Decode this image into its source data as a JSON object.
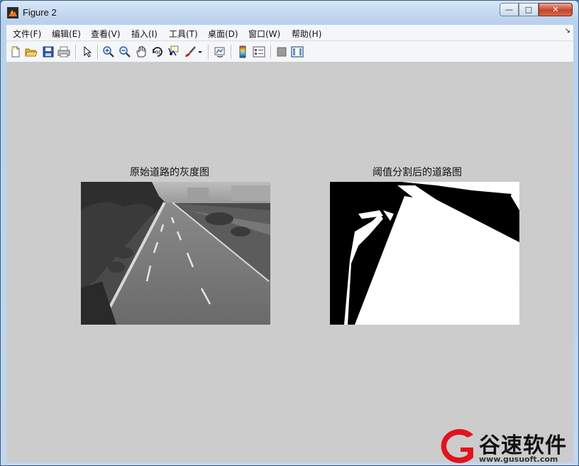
{
  "window": {
    "title": "Figure 2"
  },
  "controls": {
    "minimize": "—",
    "maximize": "□",
    "close": "✕"
  },
  "menu": {
    "items": [
      "文件(F)",
      "编辑(E)",
      "查看(V)",
      "插入(I)",
      "工具(T)",
      "桌面(D)",
      "窗口(W)",
      "帮助(H)"
    ],
    "dock_glyph": "↘"
  },
  "toolbar": {
    "icons": [
      "new-file-icon",
      "open-folder-icon",
      "save-icon",
      "print-icon",
      "select-arrow-icon",
      "zoom-in-icon",
      "zoom-out-icon",
      "pan-hand-icon",
      "rotate-3d-icon",
      "data-cursor-icon",
      "brush-icon",
      "dropdown-arrow-icon",
      "link-plot-icon",
      "colorbar-icon",
      "legend-icon",
      "hide-plot-tools-icon",
      "show-plot-tools-icon"
    ]
  },
  "figure": {
    "left_title": "原始道路的灰度图",
    "right_title": "阈值分割后的道路图"
  },
  "watermark": {
    "name": "谷速软件",
    "url": "www.gusuoft.com"
  }
}
